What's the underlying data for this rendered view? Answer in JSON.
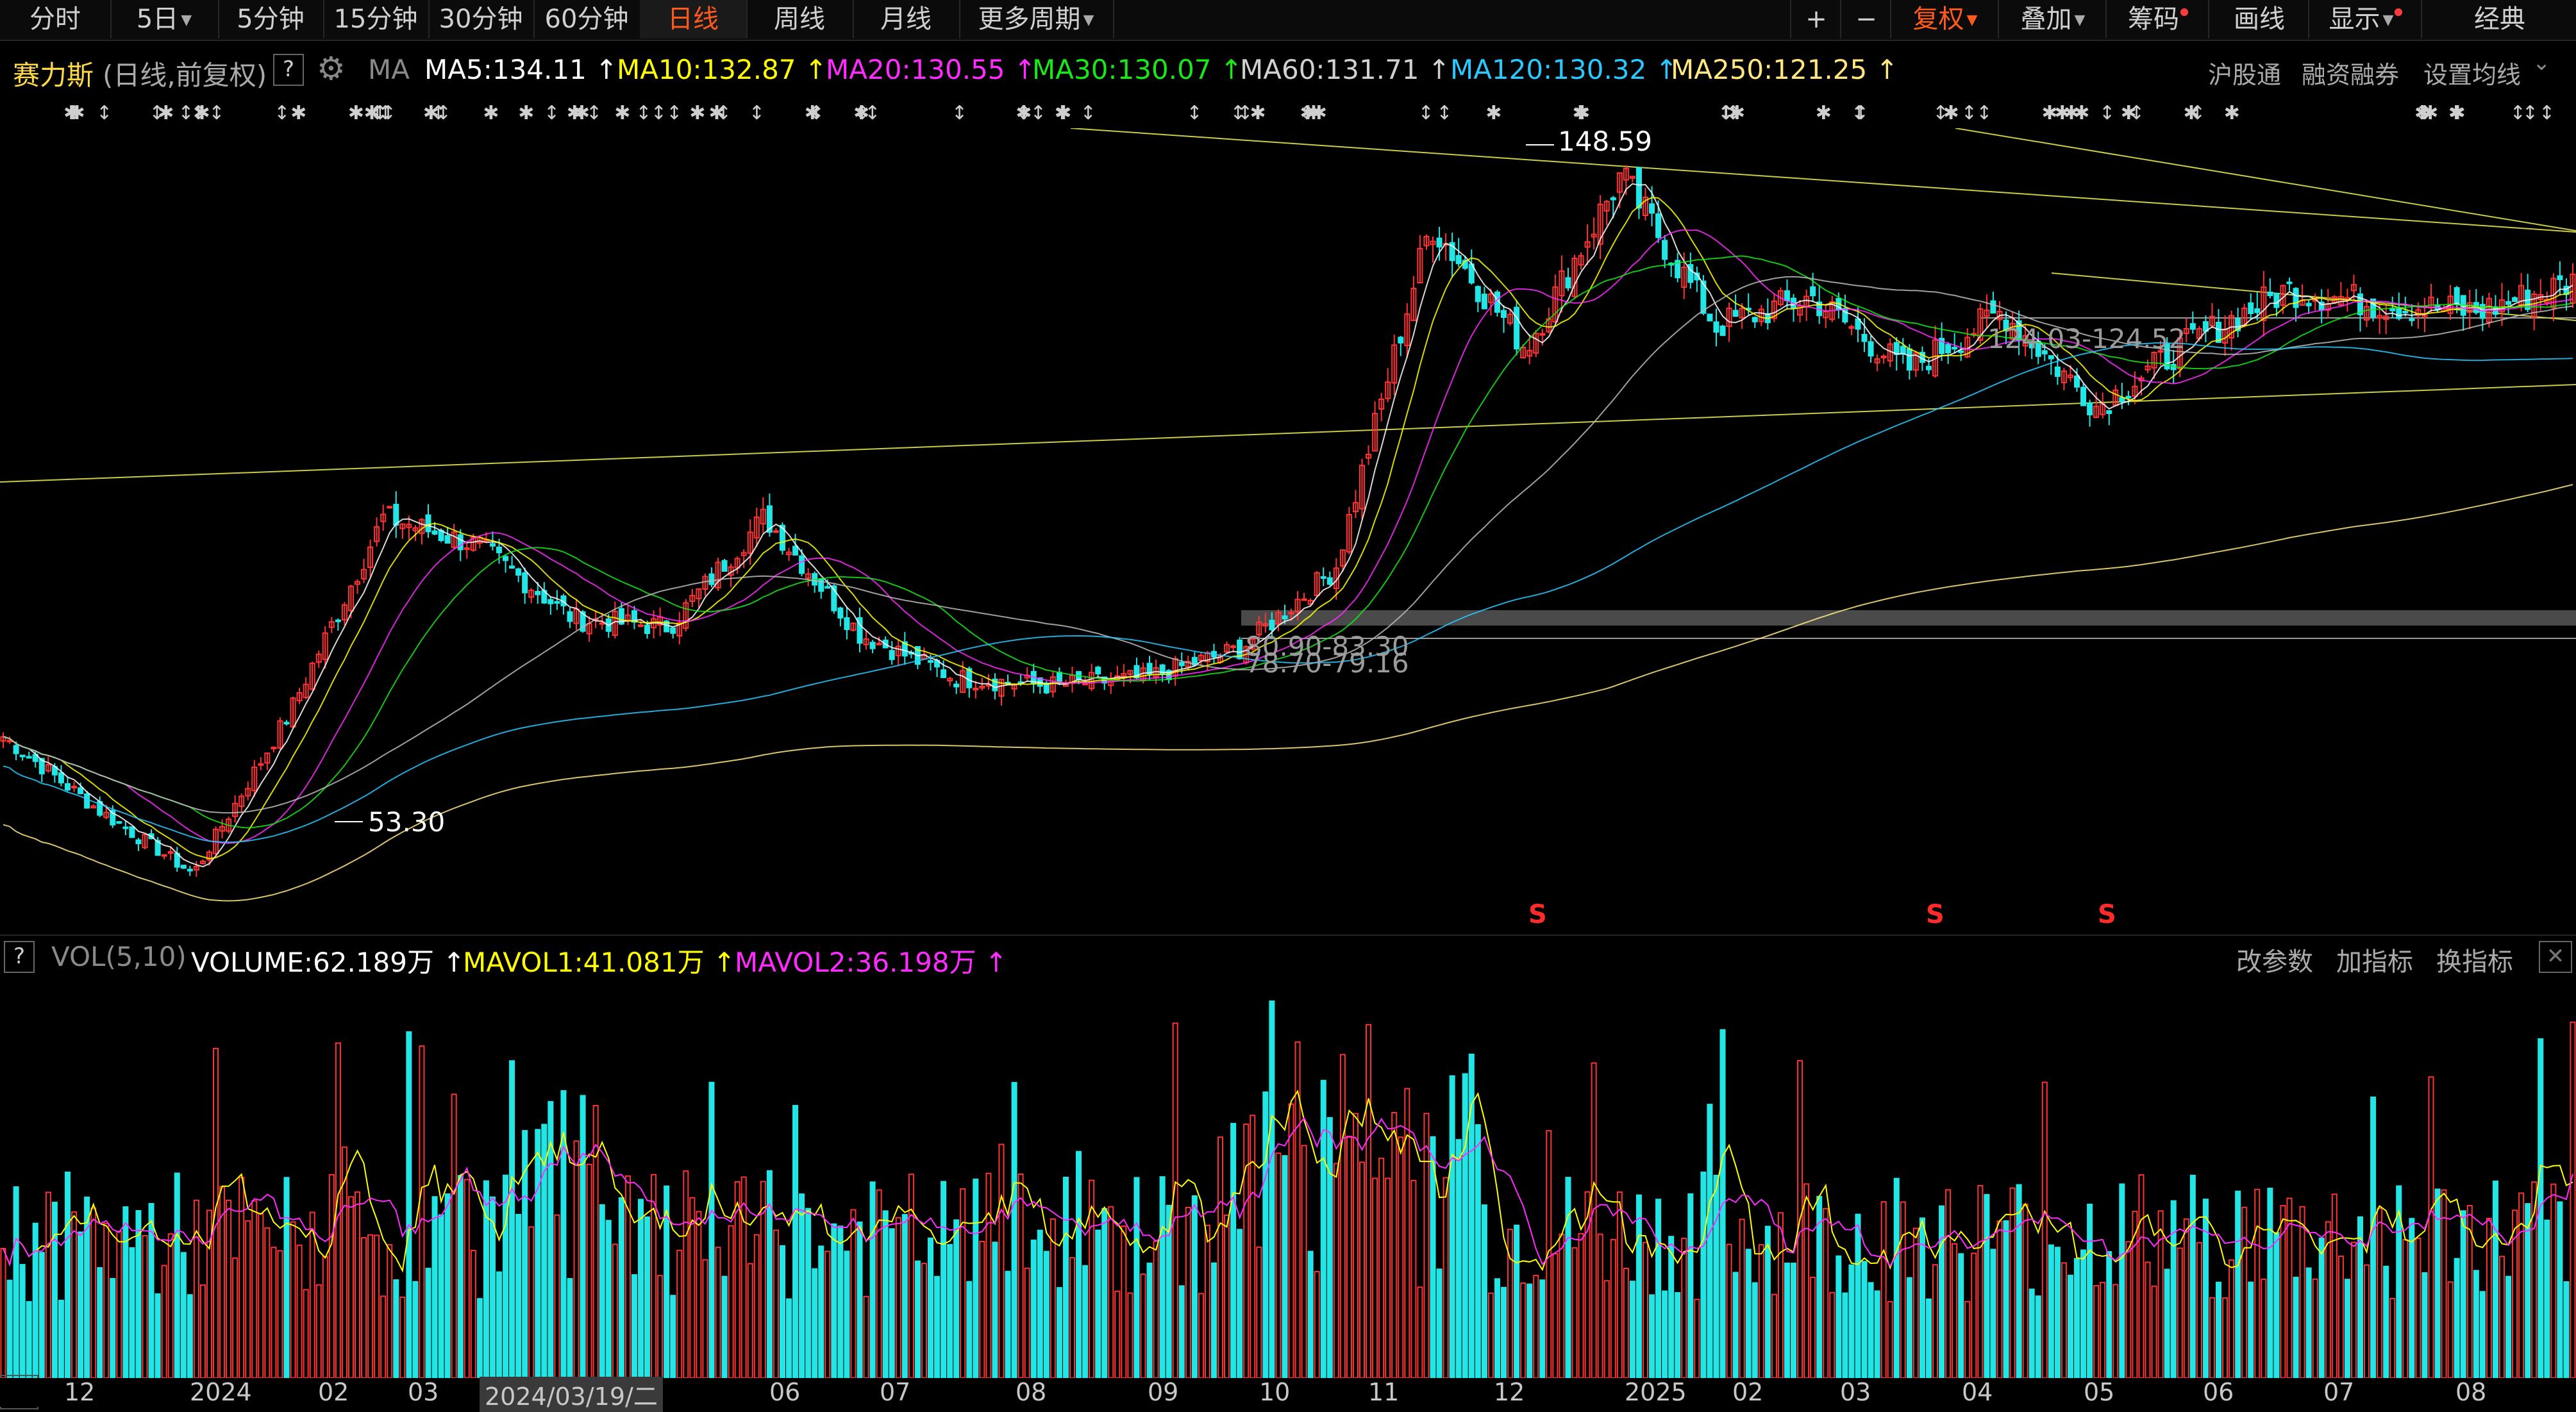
{
  "toolbar": {
    "periods": [
      "分时",
      "5日",
      "5分钟",
      "15分钟",
      "30分钟",
      "60分钟",
      "日线",
      "周线",
      "月线",
      "更多周期"
    ],
    "active_period": "日线",
    "right": {
      "zoom_in": "+",
      "zoom_out": "−",
      "adjust": "复权",
      "overlay": "叠加",
      "chips": "筹码",
      "draw": "画线",
      "display": "显示",
      "classic": "经典"
    }
  },
  "stock": {
    "name": "赛力斯",
    "mode": "(日线,前复权)",
    "help": "?",
    "indicator": "MA"
  },
  "ma_legend": [
    {
      "label": "MA5:134.11",
      "arrow": "↑",
      "color": "#ffffff"
    },
    {
      "label": "MA10:132.87",
      "arrow": "↑",
      "color": "#ffff00"
    },
    {
      "label": "MA20:130.55",
      "arrow": "↑",
      "color": "#ff2bff"
    },
    {
      "label": "MA30:130.07",
      "arrow": "↑",
      "color": "#18e818"
    },
    {
      "label": "MA60:131.71",
      "arrow": "↑",
      "color": "#d0d0d0"
    },
    {
      "label": "MA120:130.32",
      "arrow": "↑",
      "color": "#29c9ff"
    },
    {
      "label": "MA250:121.25",
      "arrow": "↑",
      "color": "#ffe680"
    }
  ],
  "top_links": [
    "沪股通",
    "融资融券",
    "设置均线"
  ],
  "annotations": {
    "high": "148.59",
    "low": "53.30",
    "zone_high": "124.03-124.52",
    "zone_mid": "80.90-83.30",
    "zone_low": "78.70-79.16",
    "s_marker": "S"
  },
  "volume": {
    "help": "?",
    "title": "VOL(5,10)",
    "volume": "VOLUME:62.189万",
    "mavol1": "MAVOL1:41.081万",
    "mavol2": "MAVOL2:36.198万",
    "arrow": "↑",
    "links": [
      "改参数",
      "加指标",
      "换指标"
    ],
    "close": "✕"
  },
  "x_axis": {
    "ticks": [
      "12",
      "2024",
      "02",
      "03",
      "2024/03/19/二",
      "06",
      "07",
      "08",
      "09",
      "10",
      "11",
      "12",
      "2025",
      "02",
      "03",
      "04",
      "05",
      "06",
      "07",
      "08"
    ],
    "nav": "«"
  },
  "colors": {
    "up": "#ff3333",
    "down": "#22e6e6",
    "accent": "#ff5a1e",
    "background": "#000000"
  },
  "chart_data": {
    "type": "candlestick",
    "price_points": [
      [
        "2023-12",
        72
      ],
      [
        "2024-01-mid",
        62
      ],
      [
        "2024-01-end",
        53.3
      ],
      [
        "2024-02",
        75
      ],
      [
        "2024-03-early",
        102
      ],
      [
        "2024-03-mid",
        98
      ],
      [
        "2024-04",
        88
      ],
      [
        "2024-05",
        87
      ],
      [
        "2024-05-end",
        102
      ],
      [
        "2024-06",
        86
      ],
      [
        "2024-07",
        80
      ],
      [
        "2024-08",
        79
      ],
      [
        "2024-09",
        80
      ],
      [
        "2024-09-end",
        84
      ],
      [
        "2024-10",
        95
      ],
      [
        "2024-11-early",
        142
      ],
      [
        "2024-11-mid",
        125
      ],
      [
        "2024-12-early",
        148.59
      ],
      [
        "2024-12-mid",
        128
      ],
      [
        "2025-01",
        132
      ],
      [
        "2025-02",
        122
      ],
      [
        "2025-03",
        130
      ],
      [
        "2025-04-early",
        117
      ],
      [
        "2025-04-mid",
        126
      ],
      [
        "2025-05",
        133
      ],
      [
        "2025-06",
        131
      ],
      [
        "2025-07",
        130
      ],
      [
        "2025-08",
        134
      ]
    ],
    "ma": {
      "MA5": 134.11,
      "MA10": 132.87,
      "MA20": 130.55,
      "MA30": 130.07,
      "MA60": 131.71,
      "MA120": 130.32,
      "MA250": 121.25
    },
    "volume_last": "62.189万",
    "mavol1": "41.081万",
    "mavol2": "36.198万",
    "ylim_price": [
      45,
      155
    ]
  }
}
